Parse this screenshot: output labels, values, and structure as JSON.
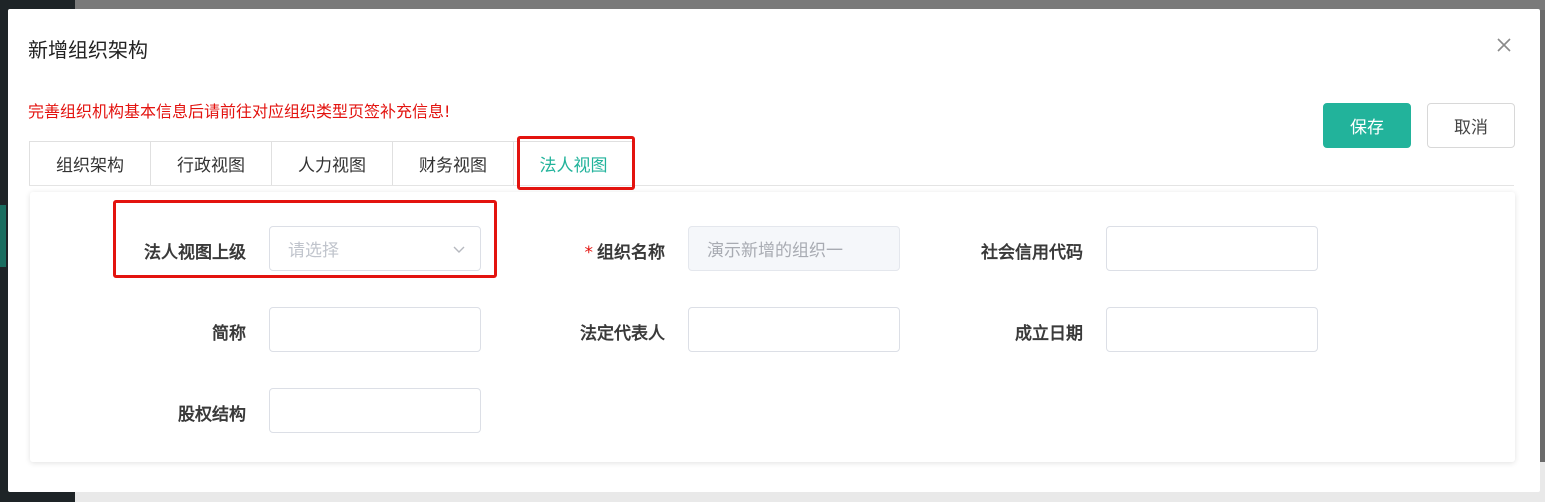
{
  "modal": {
    "title": "新增组织架构",
    "notice": "完善组织机构基本信息后请前往对应组织类型页签补充信息!",
    "save_label": "保存",
    "cancel_label": "取消"
  },
  "tabs": [
    {
      "label": "组织架构"
    },
    {
      "label": "行政视图"
    },
    {
      "label": "人力视图"
    },
    {
      "label": "财务视图"
    },
    {
      "label": "法人视图",
      "active": true
    }
  ],
  "form": {
    "parent_label": "法人视图上级",
    "parent_placeholder": "请选择",
    "org_name_required": "*",
    "org_name_label": "组织名称",
    "org_name_value": "演示新增的组织一",
    "credit_code_label": "社会信用代码",
    "credit_code_value": "",
    "short_name_label": "简称",
    "short_name_value": "",
    "legal_rep_label": "法定代表人",
    "legal_rep_value": "",
    "founded_label": "成立日期",
    "founded_value": "",
    "equity_label": "股权结构",
    "equity_value": ""
  },
  "colors": {
    "accent": "#22b39b",
    "warning": "#e3130f"
  },
  "icons": {
    "close": "close-icon",
    "dropdown": "chevron-down-icon"
  }
}
